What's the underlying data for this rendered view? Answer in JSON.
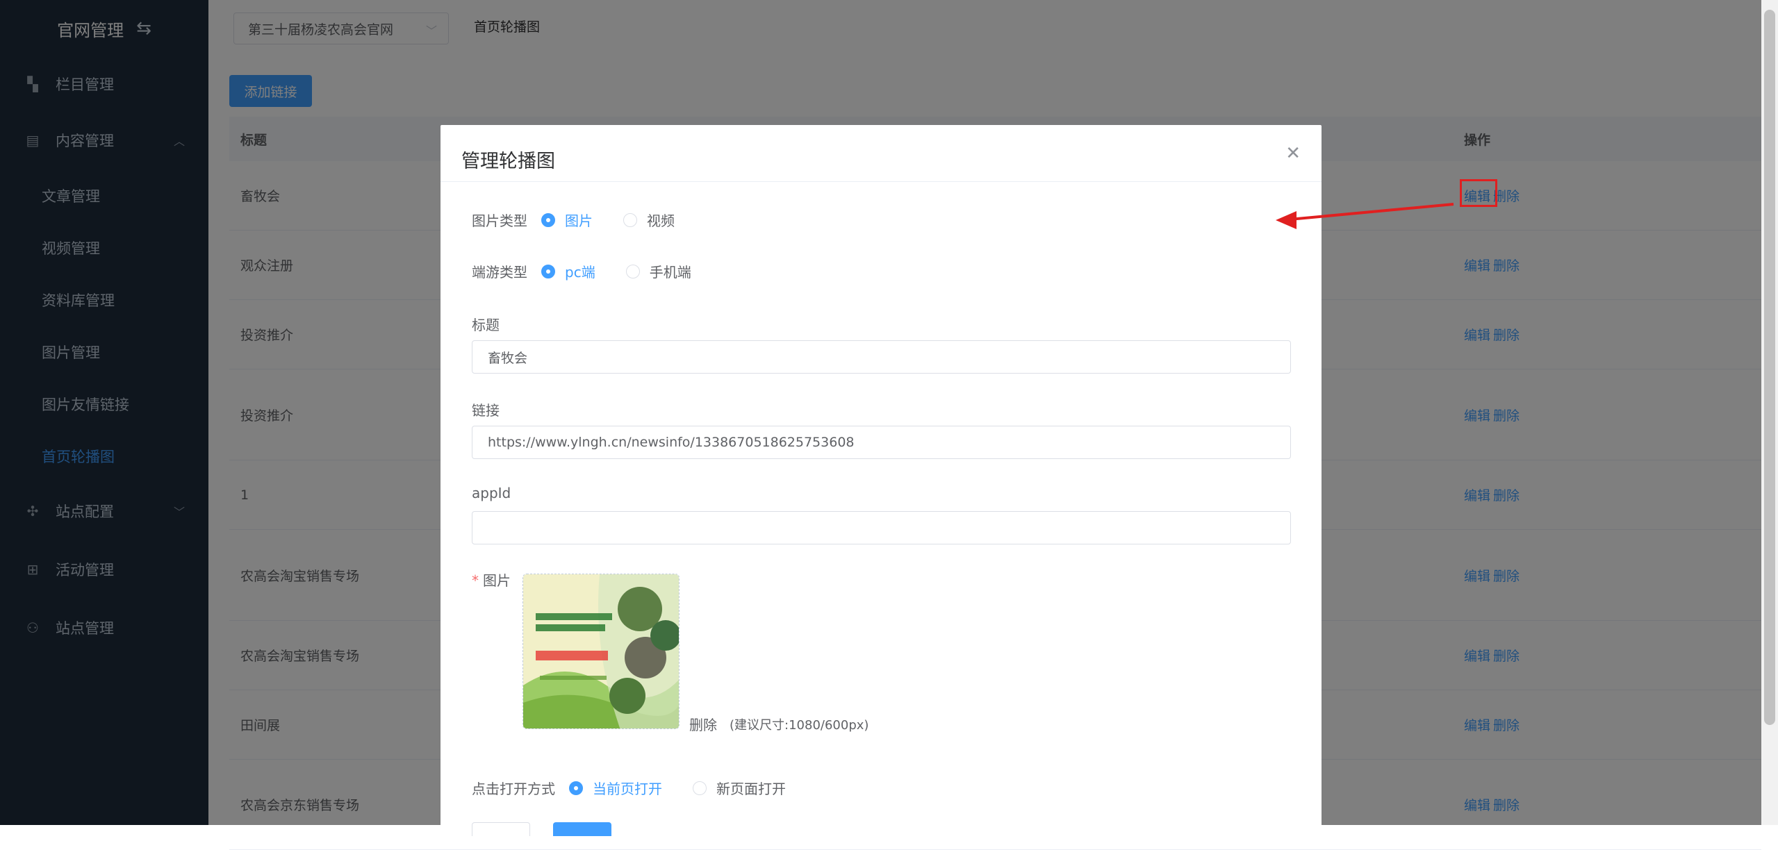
{
  "sidebar": {
    "brand": "官网管理",
    "brand_icon": "swap-icon",
    "items": [
      {
        "label": "栏目管理",
        "icon": "grid-icon"
      },
      {
        "label": "内容管理",
        "icon": "document-icon"
      },
      {
        "label": "站点配置",
        "icon": "drone-icon"
      },
      {
        "label": "活动管理",
        "icon": "plus-box-icon"
      },
      {
        "label": "站点管理",
        "icon": "sitemap-icon"
      }
    ],
    "sub_items": [
      "文章管理",
      "视频管理",
      "资料库管理",
      "图片管理",
      "图片友情链接",
      "首页轮播图"
    ],
    "active_sub": "首页轮播图"
  },
  "header": {
    "site_select": "第三十届杨凌农高会官网",
    "breadcrumb": "首页轮播图"
  },
  "toolbar": {
    "add_label": "添加链接"
  },
  "table": {
    "col_title": "标题",
    "col_ops": "操作",
    "edit_label": "编辑",
    "delete_label": "删除",
    "rows": [
      "畜牧会",
      "观众注册",
      "投资推介",
      "投资推介",
      "1",
      "农高会淘宝销售专场",
      "农高会淘宝销售专场",
      "田间展",
      "农高会京东销售专场"
    ]
  },
  "dialog": {
    "title": "管理轮播图",
    "image_type_label": "图片类型",
    "image_type_options": [
      "图片",
      "视频"
    ],
    "image_type_selected": "图片",
    "terminal_label": "端游类型",
    "terminal_options": [
      "pc端",
      "手机端"
    ],
    "terminal_selected": "pc端",
    "title_label": "标题",
    "title_value": "畜牧会",
    "link_label": "链接",
    "link_value": "https://www.ylngh.cn/newsinfo/1338670518625753608",
    "appid_label": "appId",
    "appid_value": "",
    "image_label": "图片",
    "image_delete": "删除",
    "image_hint": "(建议尺寸:1080/600px)",
    "open_label": "点击打开方式",
    "open_options": [
      "当前页打开",
      "新页面打开"
    ],
    "open_selected": "当前页打开"
  },
  "colors": {
    "sidebar_bg": "#1f2d3d",
    "accent": "#409eff",
    "annotation": "#e02020"
  }
}
